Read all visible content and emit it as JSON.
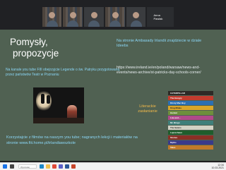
{
  "video_call": {
    "participants": [
      {
        "name": ""
      },
      {
        "name": ""
      },
      {
        "name": ""
      },
      {
        "name": ""
      },
      {
        "name": ""
      },
      {
        "name": "Anna Pawlak"
      }
    ]
  },
  "slide": {
    "title_line1": "Pomysły,",
    "title_line2": "propozycje",
    "left_text": "Na kanale you tube FIII obejrzyjcie Legende o św. Patryku przygotowaną przez państwów Teatr w Poznaniu",
    "right_top_text": "Na stronie Ambasady Irlandii znajdziecie w dziale Ideebs",
    "link_text": "https://www.ireland.ie/en/poland/warsaw/news-and-events/news-archive/st-patricks-day-schools-corner/",
    "caption": "Literackie zasłanianie",
    "bottom_text": "Korzystajcie z filmów na naszym you tube; nagranych lekcji i materiałów na stronie www.fiii.home.pl/irlandiawszkole",
    "books": [
      {
        "label": "CATERPILLAR",
        "color": "#2d2a26"
      },
      {
        "label": "The Hungry",
        "color": "#c23b2e"
      },
      {
        "label": "Kirsty Mac Boy",
        "color": "#2b6fb3"
      },
      {
        "label": "King Midas",
        "color": "#d9a62a"
      },
      {
        "label": "Hamlet",
        "color": "#6e8f3c"
      },
      {
        "label": "Liza and...",
        "color": "#b04a8a"
      },
      {
        "label": "Mr. Bingo",
        "color": "#3f7f7a"
      },
      {
        "label": "The Swans",
        "color": "#d1d1c4"
      },
      {
        "label": "Leprechaun",
        "color": "#1f5d2c"
      },
      {
        "label": "Stories",
        "color": "#8a2f25"
      },
      {
        "label": "Myths",
        "color": "#3a3a8a"
      },
      {
        "label": "Tales",
        "color": "#c07a2a"
      }
    ]
  },
  "taskbar": {
    "search_placeholder": "Wyszukaj",
    "time": "12:34",
    "date": "10.03.2021",
    "icons": [
      {
        "name": "start-icon",
        "color": "#1a73e8"
      },
      {
        "name": "task-view-icon",
        "color": "#444444"
      },
      {
        "name": "edge-icon",
        "color": "#1e88c8"
      },
      {
        "name": "explorer-icon",
        "color": "#f2c14e"
      },
      {
        "name": "chrome-icon",
        "color": "#e04a3a"
      },
      {
        "name": "teams-icon",
        "color": "#5b5fc7"
      },
      {
        "name": "word-icon",
        "color": "#2b5797"
      },
      {
        "name": "powerpoint-icon",
        "color": "#c8462b"
      }
    ]
  }
}
